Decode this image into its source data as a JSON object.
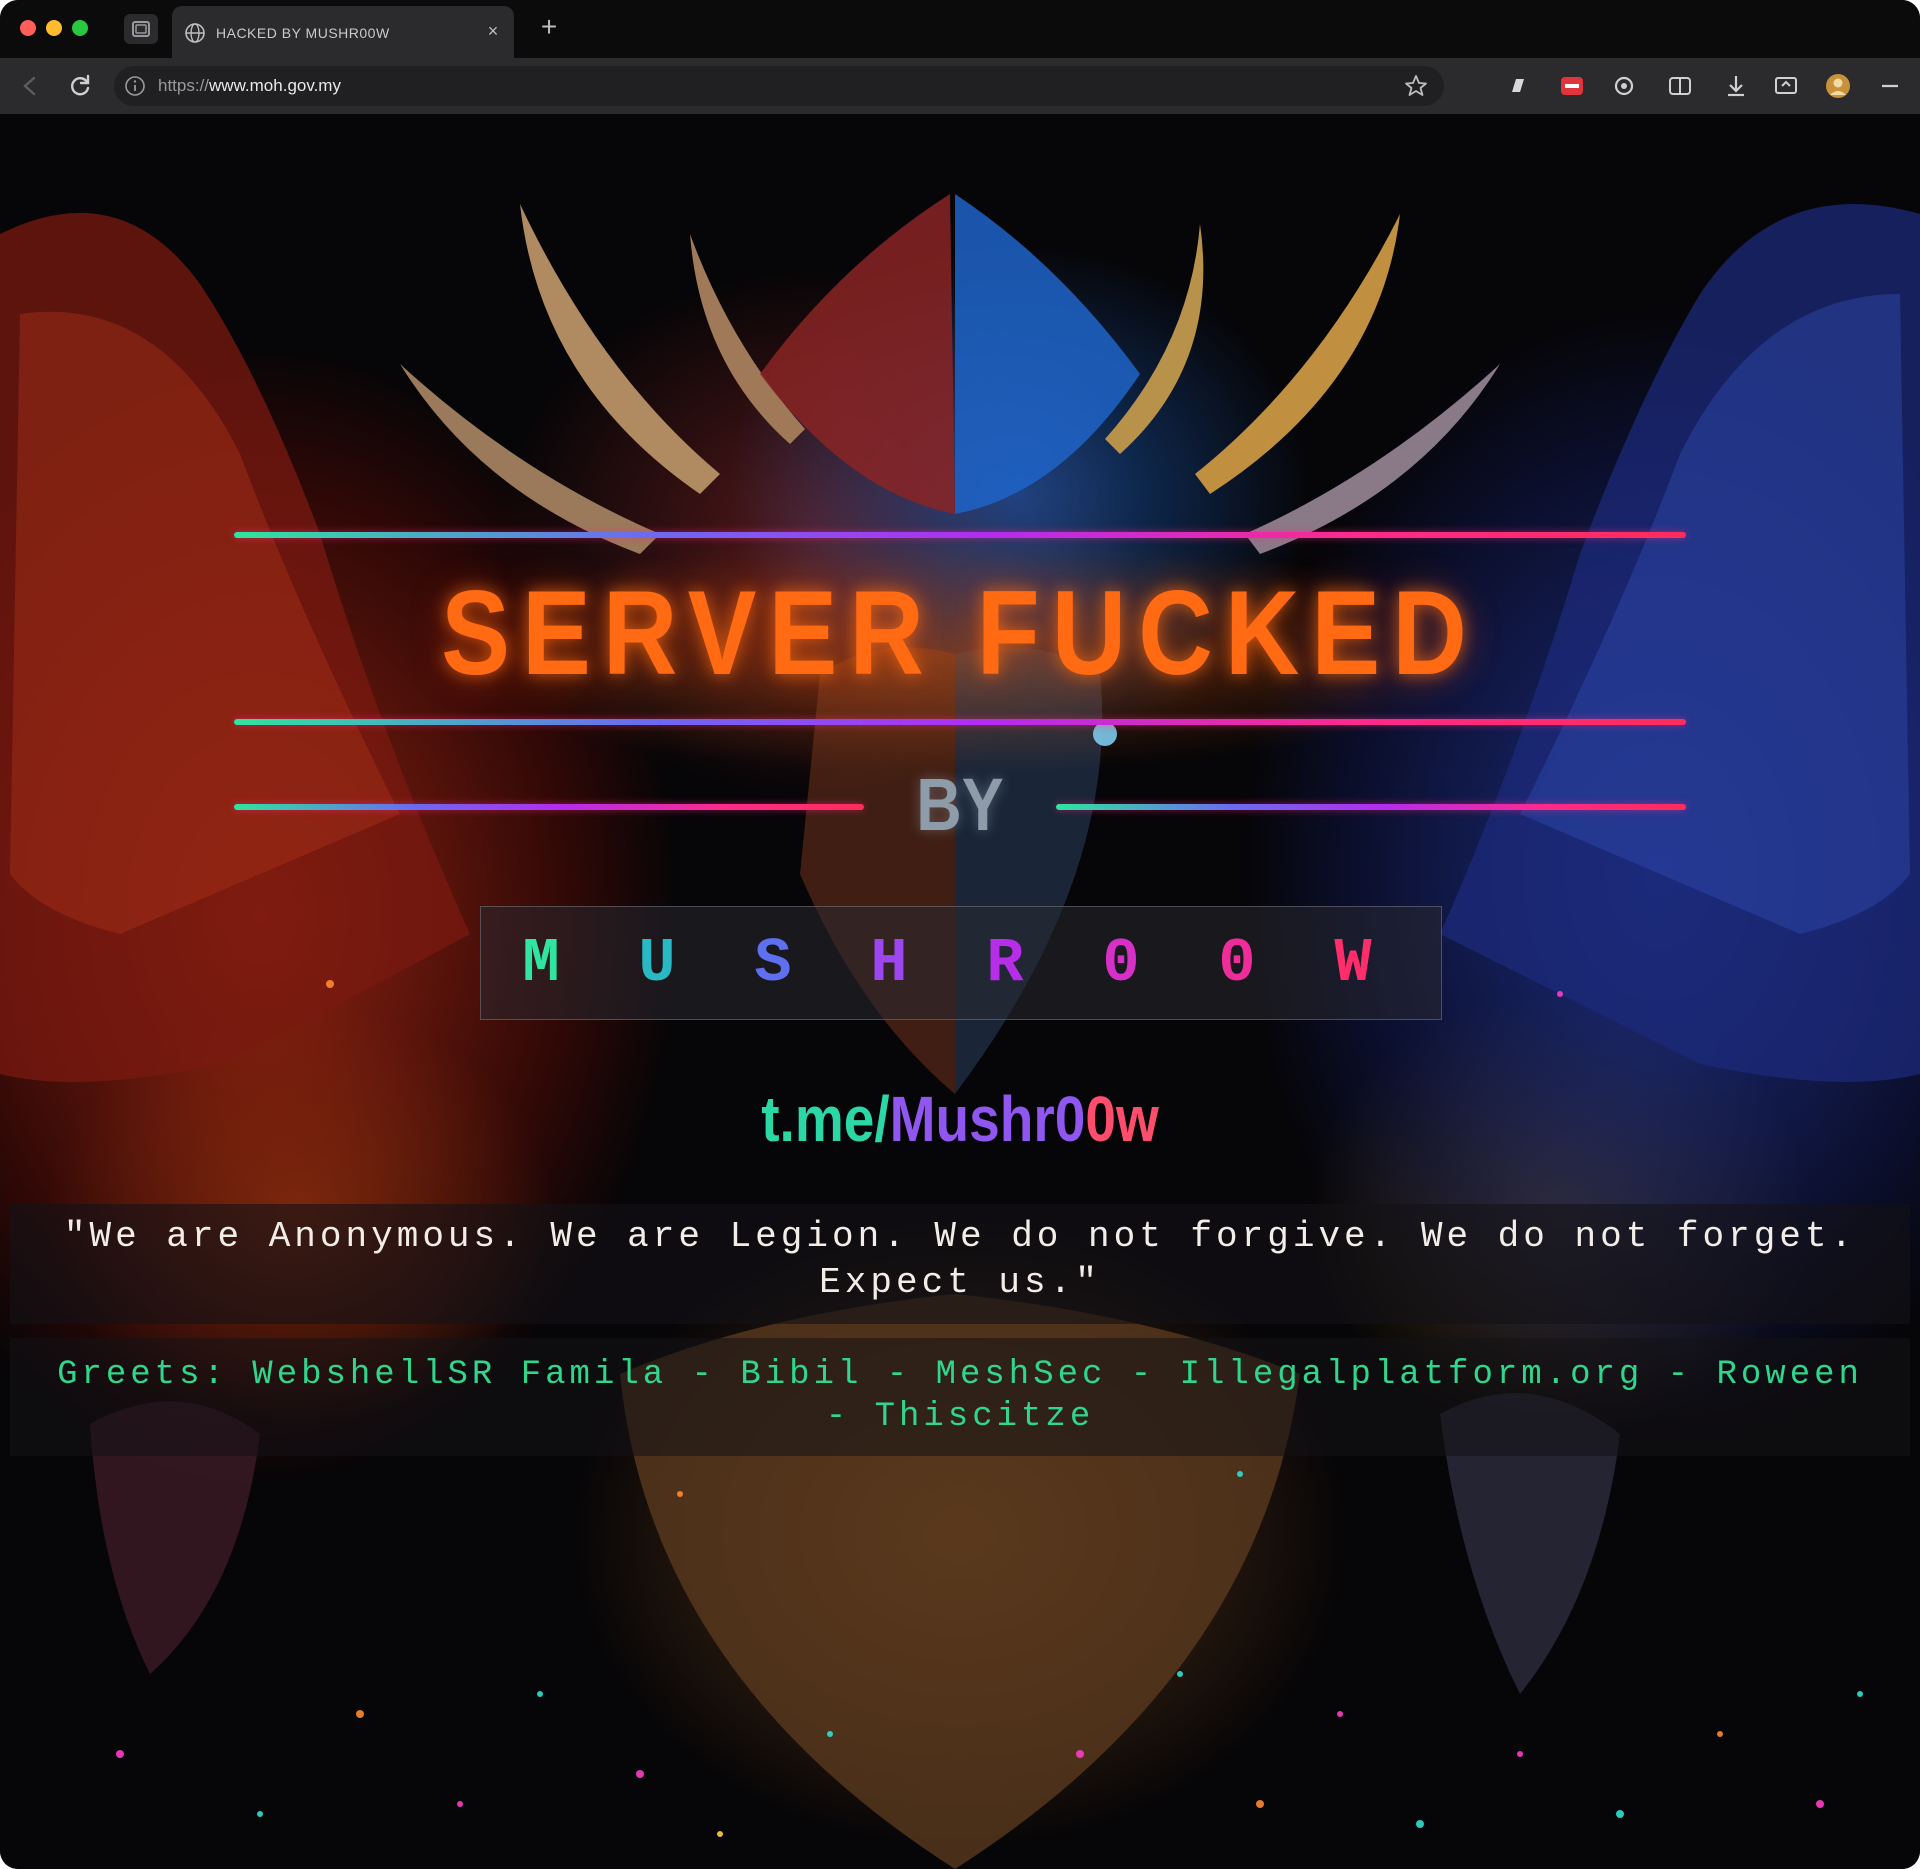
{
  "browser": {
    "tab_title": "HACKED BY MUSHR00W",
    "url_scheme": "https://",
    "url_host": "www.moh.gov.my",
    "close_glyph": "×",
    "new_tab_glyph": "+"
  },
  "page": {
    "headline": "SERVER FUCKED",
    "by": "BY",
    "name_letters": [
      {
        "char": "M",
        "color": "#2fe59f"
      },
      {
        "char": "U",
        "color": "#29b9c4"
      },
      {
        "char": "S",
        "color": "#5e6ff0"
      },
      {
        "char": "H",
        "color": "#9b46ef"
      },
      {
        "char": "R",
        "color": "#b62ee8"
      },
      {
        "char": "0",
        "color": "#d630c9"
      },
      {
        "char": "0",
        "color": "#ef2d9a"
      },
      {
        "char": "W",
        "color": "#ff2d6a"
      }
    ],
    "telegram": {
      "part1": "t.me/",
      "part2": "Mushr0",
      "part3": "0w"
    },
    "quote": "\"We are Anonymous. We are Legion. We do not forgive. We do not forget. Expect us.\"",
    "greets": "Greets: WebshellSR Famila - Bibil - MeshSec - Illegalplatform.org - Roween - Thiscitze"
  },
  "colors": {
    "headline": "#ff6a12",
    "greets": "#30d68c",
    "line_gradient": [
      "#2ee59d",
      "#6a6cf0",
      "#b32cf0",
      "#ff2a8a",
      "#ff2d5a"
    ]
  }
}
